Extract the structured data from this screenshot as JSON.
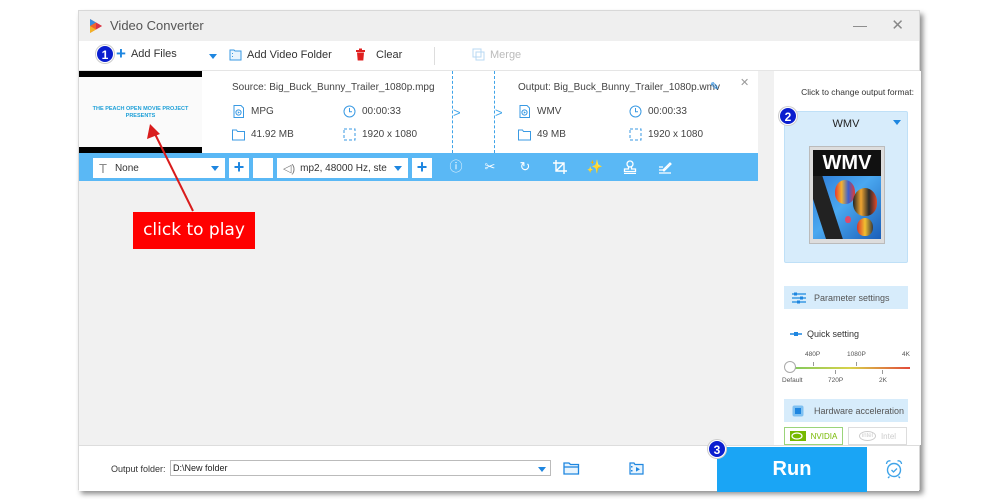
{
  "window": {
    "title": "Video Converter",
    "minimize_glyph": "—",
    "close_glyph": "✕"
  },
  "toolbar": {
    "add_files": "Add Files",
    "add_video_folder": "Add Video Folder",
    "clear": "Clear",
    "merge": "Merge"
  },
  "badges": {
    "step1": "1",
    "step2": "2",
    "step3": "3"
  },
  "file": {
    "thumbnail_text_line1": "THE PEACH OPEN MOVIE PROJECT",
    "thumbnail_text_line2": "PRESENTS",
    "source": {
      "label": "Source: Big_Buck_Bunny_Trailer_1080p.mpg",
      "format": "MPG",
      "duration": "00:00:33",
      "size": "41.92 MB",
      "resolution": "1920 x 1080"
    },
    "output": {
      "label": "Output: Big_Buck_Bunny_Trailer_1080p.wmv",
      "format": "WMV",
      "duration": "00:00:33",
      "size": "49 MB",
      "resolution": "1920 x 1080"
    }
  },
  "edit_bar": {
    "subtitle_select": "None",
    "audio_select": "mp2, 48000 Hz, ste",
    "tools": [
      "info-icon",
      "scissors-icon",
      "rotate-icon",
      "crop-icon",
      "effects-wand-icon",
      "watermark-stamp-icon",
      "edit-subtitle-icon"
    ]
  },
  "callout": {
    "text": "click to play"
  },
  "right_panel": {
    "caption": "Click to change output format:",
    "format": "WMV",
    "format_image_text": "WMV",
    "parameter_settings": "Parameter settings",
    "quick_setting": "Quick setting",
    "quality_top_labels": [
      "480P",
      "1080P",
      "4K"
    ],
    "quality_bottom_labels": [
      "Default",
      "720P",
      "2K"
    ],
    "quality_selected": "Default",
    "hardware_acceleration": "Hardware acceleration",
    "nvidia": "NVIDIA",
    "intel": "Intel"
  },
  "bottom": {
    "output_folder_label": "Output folder:",
    "output_folder_value": "D:\\New folder",
    "run": "Run"
  },
  "colors": {
    "accent_blue": "#1aa5f5",
    "edit_bar_blue": "#5ab8f5",
    "badge_blue": "#0a1ecf",
    "callout_red": "#ff0000",
    "clear_red": "#e02020",
    "nvidia_green": "#76b900"
  }
}
